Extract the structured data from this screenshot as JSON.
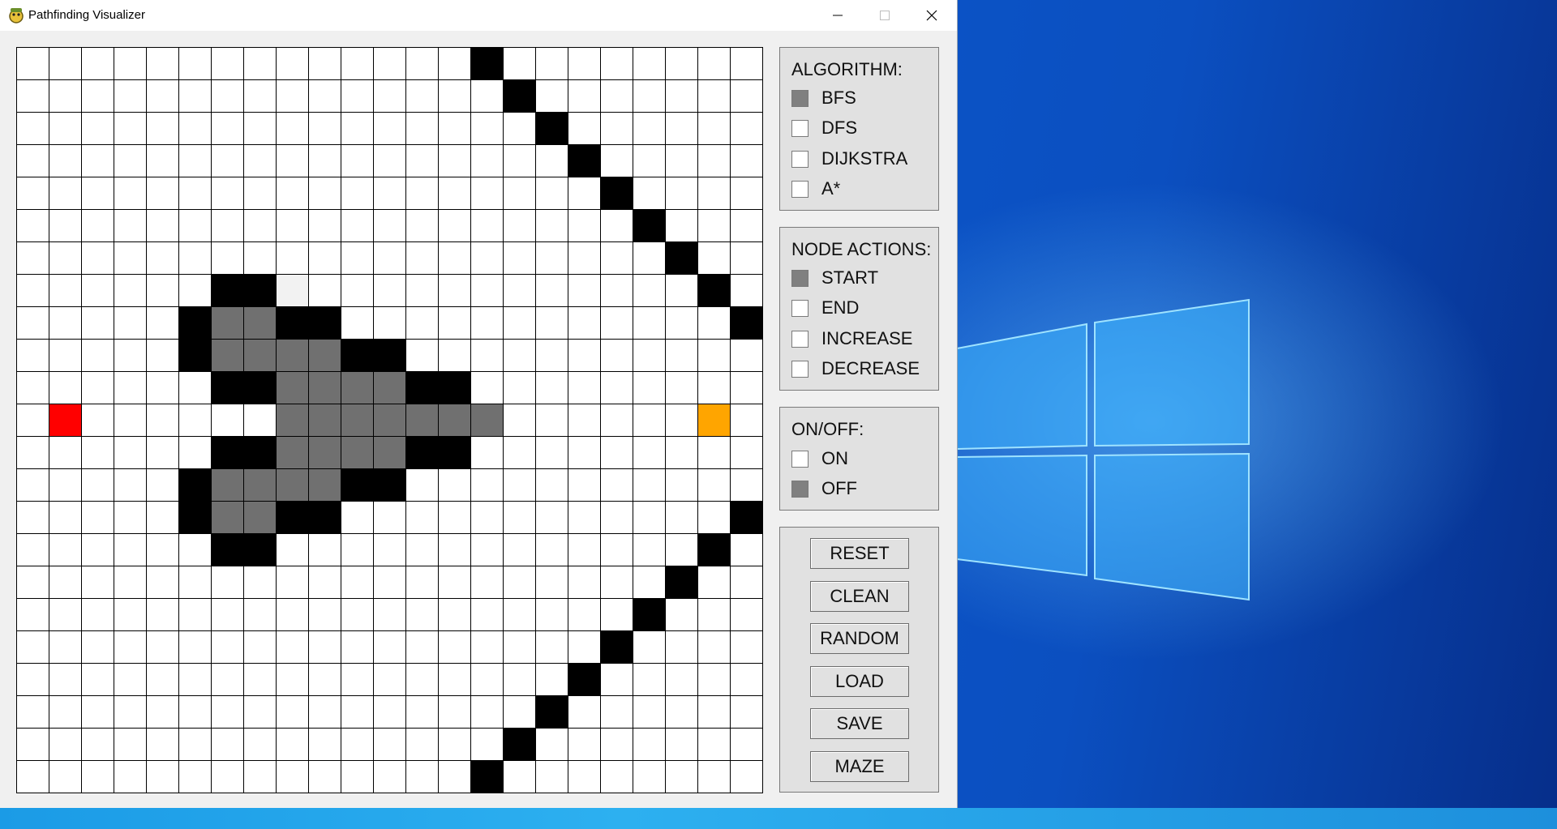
{
  "window": {
    "title": "Pathfinding Visualizer",
    "icon": "python-snake-icon"
  },
  "grid": {
    "cols": 23,
    "rows": 23,
    "colors": {
      "empty": "#ffffff",
      "wall": "#000000",
      "visited": "#707070",
      "start": "#ff0000",
      "end": "#ffa500",
      "light": "#f2f2f2"
    },
    "walls": [
      [
        14,
        0
      ],
      [
        15,
        1
      ],
      [
        16,
        2
      ],
      [
        17,
        3
      ],
      [
        18,
        4
      ],
      [
        19,
        5
      ],
      [
        20,
        6
      ],
      [
        21,
        7
      ],
      [
        22,
        8
      ],
      [
        6,
        7
      ],
      [
        7,
        7
      ],
      [
        5,
        8
      ],
      [
        8,
        8
      ],
      [
        9,
        8
      ],
      [
        5,
        9
      ],
      [
        10,
        9
      ],
      [
        11,
        9
      ],
      [
        6,
        10
      ],
      [
        7,
        10
      ],
      [
        12,
        10
      ],
      [
        13,
        10
      ],
      [
        6,
        12
      ],
      [
        7,
        12
      ],
      [
        12,
        12
      ],
      [
        13,
        12
      ],
      [
        5,
        13
      ],
      [
        10,
        13
      ],
      [
        11,
        13
      ],
      [
        5,
        14
      ],
      [
        8,
        14
      ],
      [
        9,
        14
      ],
      [
        6,
        15
      ],
      [
        7,
        15
      ],
      [
        22,
        14
      ],
      [
        21,
        15
      ],
      [
        20,
        16
      ],
      [
        19,
        17
      ],
      [
        18,
        18
      ],
      [
        17,
        19
      ],
      [
        16,
        20
      ],
      [
        15,
        21
      ],
      [
        14,
        22
      ]
    ],
    "visited": [
      [
        6,
        8
      ],
      [
        7,
        8
      ],
      [
        6,
        9
      ],
      [
        7,
        9
      ],
      [
        8,
        9
      ],
      [
        9,
        9
      ],
      [
        8,
        10
      ],
      [
        9,
        10
      ],
      [
        10,
        10
      ],
      [
        11,
        10
      ],
      [
        8,
        11
      ],
      [
        9,
        11
      ],
      [
        10,
        11
      ],
      [
        11,
        11
      ],
      [
        12,
        11
      ],
      [
        13,
        11
      ],
      [
        14,
        11
      ],
      [
        8,
        12
      ],
      [
        9,
        12
      ],
      [
        10,
        12
      ],
      [
        11,
        12
      ],
      [
        6,
        13
      ],
      [
        7,
        13
      ],
      [
        8,
        13
      ],
      [
        9,
        13
      ],
      [
        6,
        14
      ],
      [
        7,
        14
      ]
    ],
    "light": [
      [
        8,
        7
      ]
    ],
    "start": [
      1,
      11
    ],
    "end": [
      21,
      11
    ]
  },
  "algorithm": {
    "title": "ALGORITHM:",
    "options": [
      {
        "label": "BFS",
        "checked": true
      },
      {
        "label": "DFS",
        "checked": false
      },
      {
        "label": "DIJKSTRA",
        "checked": false
      },
      {
        "label": "A*",
        "checked": false
      }
    ]
  },
  "node_actions": {
    "title": "NODE ACTIONS:",
    "options": [
      {
        "label": "START",
        "checked": true
      },
      {
        "label": "END",
        "checked": false
      },
      {
        "label": "INCREASE",
        "checked": false
      },
      {
        "label": "DECREASE",
        "checked": false
      }
    ]
  },
  "onoff": {
    "title": "ON/OFF:",
    "options": [
      {
        "label": "ON",
        "checked": false
      },
      {
        "label": "OFF",
        "checked": true
      }
    ]
  },
  "buttons": {
    "reset": "RESET",
    "clean": "CLEAN",
    "random": "RANDOM",
    "load": "LOAD",
    "save": "SAVE",
    "maze": "MAZE"
  }
}
